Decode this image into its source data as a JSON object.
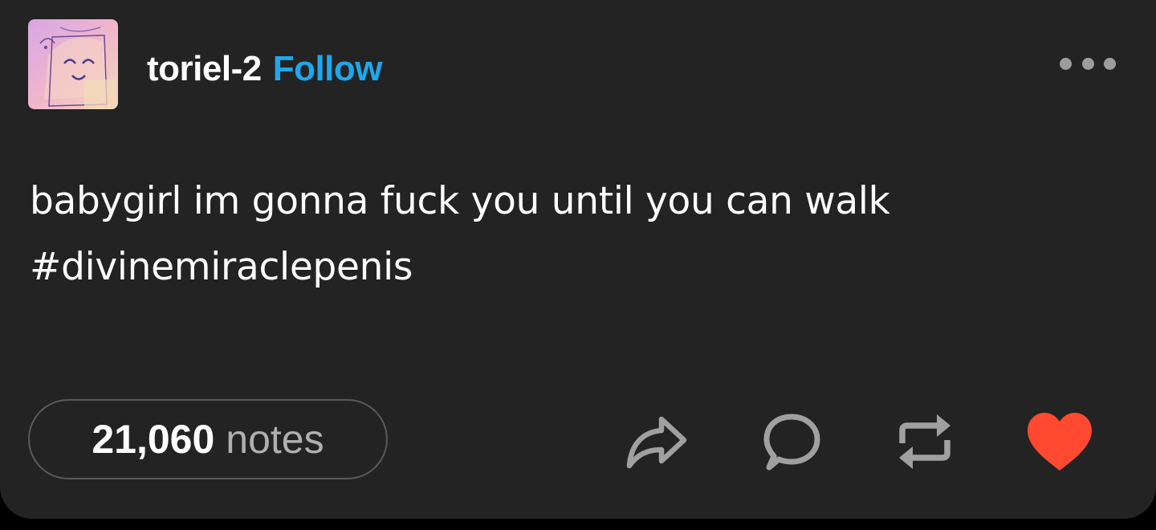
{
  "post": {
    "username": "toriel-2",
    "follow_label": "Follow",
    "body_lines": [
      "babygirl im gonna fuck you until you can walk",
      "#divinemiraclepenis"
    ],
    "notes_count": "21,060",
    "notes_label": "notes"
  },
  "icons": {
    "avatar": "avatar-image",
    "more": "more-options-icon",
    "share": "share-icon",
    "reply": "reply-icon",
    "reblog": "reblog-icon",
    "like": "heart-icon"
  },
  "colors": {
    "card_background": "#232323",
    "follow": "#1fa7ec",
    "heart": "#ff4930",
    "icon_gray": "#a0a0a0"
  },
  "state": {
    "liked": true
  }
}
